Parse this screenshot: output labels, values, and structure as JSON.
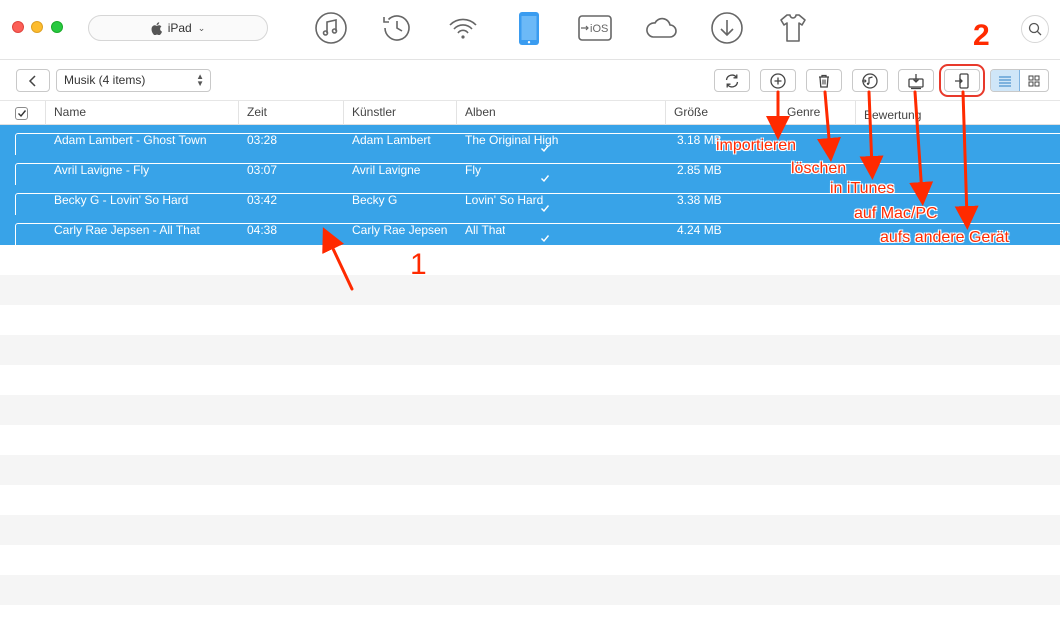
{
  "device": {
    "name": "iPad"
  },
  "top_icons": [
    "music-icon",
    "history-icon",
    "wifi-sync-icon",
    "device-icon",
    "to-ios-icon",
    "cloud-icon",
    "download-icon",
    "shirt-icon"
  ],
  "to_ios_label": "iOS",
  "toolbar": {
    "category": "Musik (4 items)",
    "buttons": [
      "refresh-icon",
      "add-icon",
      "trash-icon",
      "itunes-icon",
      "to-computer-icon",
      "to-device-icon"
    ]
  },
  "table": {
    "columns": [
      "Name",
      "Zeit",
      "Künstler",
      "Alben",
      "Größe",
      "Genre",
      "Bewertung"
    ],
    "rows": [
      {
        "name": "Adam Lambert - Ghost Town",
        "time": "03:28",
        "artist": "Adam Lambert",
        "album": "The Original High",
        "size": "3.18 MB"
      },
      {
        "name": "Avril Lavigne - Fly",
        "time": "03:07",
        "artist": "Avril Lavigne",
        "album": "Fly",
        "size": "2.85 MB"
      },
      {
        "name": "Becky G - Lovin' So Hard",
        "time": "03:42",
        "artist": "Becky G",
        "album": "Lovin' So Hard",
        "size": "3.38 MB"
      },
      {
        "name": "Carly Rae Jepsen - All That",
        "time": "04:38",
        "artist": "Carly Rae Jepsen",
        "album": "All That",
        "size": "4.24 MB"
      }
    ]
  },
  "annotations": {
    "step1": "1",
    "step2": "2",
    "import": "importieren",
    "delete": "löschen",
    "itunes": "in iTunes",
    "mac_pc": "auf Mac/PC",
    "other_device": "aufs andere Gerät"
  },
  "colors": {
    "selection": "#38a3e8",
    "annotation": "#ff2a00",
    "active_tab": "#3a9cf0"
  }
}
